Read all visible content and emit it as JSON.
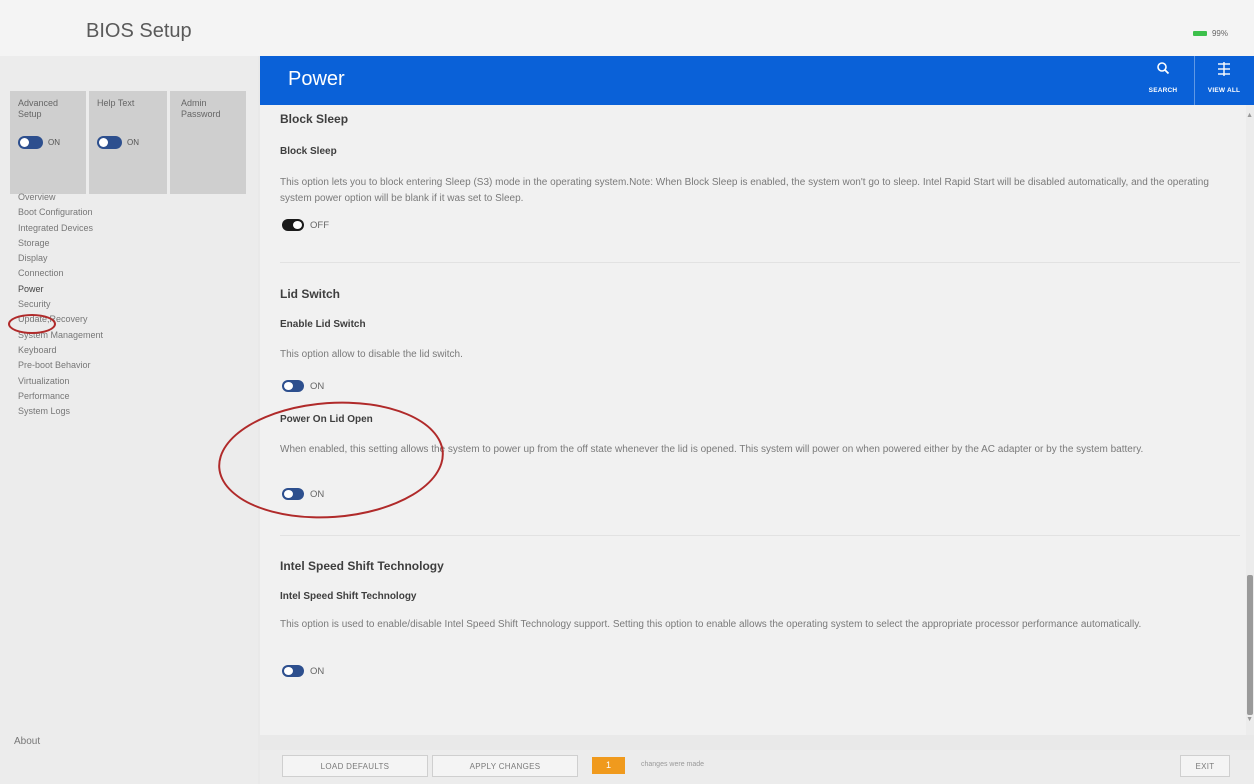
{
  "app": {
    "title": "BIOS Setup"
  },
  "status": {
    "battery_text": "99%",
    "battery_color": "#3cc04b"
  },
  "sidebar": {
    "tiles": [
      {
        "label": "Advanced Setup",
        "toggle": "ON"
      },
      {
        "label": "Help Text",
        "toggle": "ON"
      },
      {
        "label": "Admin Password"
      }
    ],
    "nav": [
      "Overview",
      "Boot Configuration",
      "Integrated Devices",
      "Storage",
      "Display",
      "Connection",
      "Power",
      "Security",
      "Update,Recovery",
      "System Management",
      "Keyboard",
      "Pre-boot Behavior",
      "Virtualization",
      "Performance",
      "System Logs"
    ],
    "active_item": "Power",
    "about_label": "About"
  },
  "header": {
    "title": "Power",
    "search_label": "SEARCH",
    "view_all_label": "VIEW ALL",
    "accent_color": "#0a61d8"
  },
  "sections": {
    "block_sleep": {
      "title": "Block Sleep",
      "subtitle": "Block Sleep",
      "description": "This option lets you to block entering Sleep (S3) mode in the operating system.Note: When Block Sleep is enabled, the system won't go to sleep. Intel Rapid Start will be disabled automatically, and the operating system power option will be blank if it was set to Sleep.",
      "toggle": "OFF"
    },
    "lid_switch": {
      "title": "Lid Switch",
      "subtitle": "Enable Lid Switch",
      "description": "This option allow to disable the lid switch.",
      "toggle": "ON",
      "power_on_title": "Power On Lid Open",
      "power_on_description": "When enabled, this setting allows the system to power up from the off state whenever the lid is opened. This system will power on when powered either by the AC adapter or by the system battery.",
      "power_on_toggle": "ON"
    },
    "speed_shift": {
      "title": "Intel Speed Shift Technology",
      "subtitle": "Intel Speed Shift Technology",
      "description": "This option is used to enable/disable Intel Speed Shift Technology support. Setting this option to enable allows the operating system to select the appropriate processor performance automatically.",
      "toggle": "ON"
    }
  },
  "footer": {
    "load_defaults": "LOAD DEFAULTS",
    "apply_changes": "APPLY CHANGES",
    "change_count": "1",
    "changes_text": "changes were made",
    "exit": "EXIT",
    "badge_color": "#f09a1d"
  }
}
